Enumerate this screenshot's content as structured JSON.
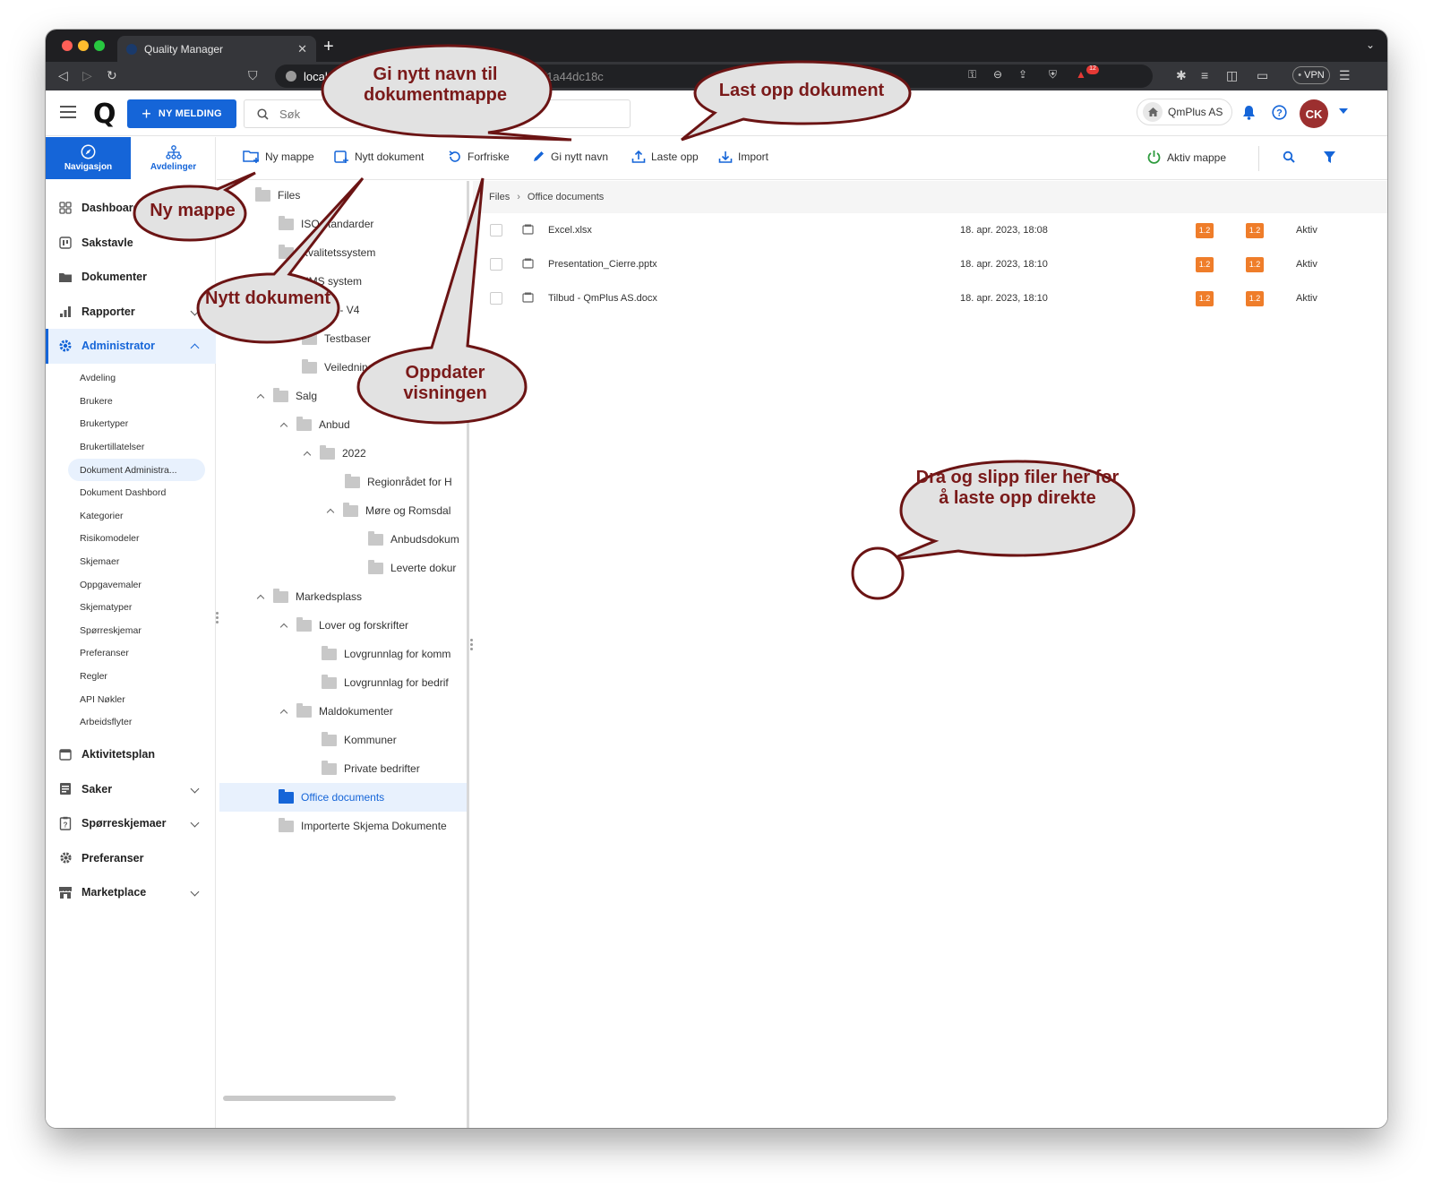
{
  "browser": {
    "tab_title": "Quality Manager",
    "url_host": "local",
    "url_rest": "mentId=9efb59cbf1a44dc18c",
    "vpn_label": "VPN",
    "shield_count": "12"
  },
  "header": {
    "new_message": "NY MELDING",
    "search_placeholder": "Søk",
    "company": "QmPlus AS",
    "avatar_initials": "CK"
  },
  "nav_tabs": [
    {
      "label": "Navigasjon",
      "icon": "compass-icon"
    },
    {
      "label": "Avdelinger",
      "icon": "org-chart-icon"
    }
  ],
  "menu": {
    "dashboard": "Dashboard",
    "sakstavle": "Sakstavle",
    "dokumenter": "Dokumenter",
    "rapporter": "Rapporter",
    "administrator": "Administrator",
    "admin_sub": [
      "Avdeling",
      "Brukere",
      "Brukertyper",
      "Brukertillatelser",
      "Dokument Administra...",
      "Dokument Dashbord",
      "Kategorier",
      "Risikomodeler",
      "Skjemaer",
      "Oppgavemaler",
      "Skjematyper",
      "Spørreskjemar",
      "Preferanser",
      "Regler",
      "API Nøkler",
      "Arbeidsflyter"
    ],
    "aktivitetsplan": "Aktivitetsplan",
    "saker": "Saker",
    "sporreskjemaer": "Spørreskjemaer",
    "preferanser": "Preferanser",
    "marketplace": "Marketplace"
  },
  "actions": {
    "ny_mappe": "Ny mappe",
    "nytt_dokument": "Nytt dokument",
    "forfriske": "Forfriske",
    "gi_nytt_navn": "Gi nytt navn",
    "laste_opp": "Laste opp",
    "import": "Import",
    "aktiv_mappe": "Aktiv mappe"
  },
  "tree": {
    "files": "Files",
    "iso": "ISO standarder",
    "kval": "Kvalitetssystem",
    "hms": "HMS system",
    "versjon": "Versjon - V4",
    "testbaser": "Testbaser",
    "veiledning": "Veiledning",
    "salg": "Salg",
    "anbud": "Anbud",
    "y2022": "2022",
    "regionradet": "Regionrådet for H",
    "more": "Møre og Romsdal",
    "anbudsdok": "Anbudsdokum",
    "leverte": "Leverte dokur",
    "markedsplass": "Markedsplass",
    "lover": "Lover og forskrifter",
    "lovgrunn1": "Lovgrunnlag for komm",
    "lovgrunn2": "Lovgrunnlag for bedrif",
    "maldok": "Maldokumenter",
    "kommuner": "Kommuner",
    "private": "Private bedrifter",
    "office": "Office documents",
    "importerte": "Importerte Skjema Dokumente"
  },
  "breadcrumb": [
    "Files",
    "Office documents"
  ],
  "files": [
    {
      "name": "Excel.xlsx",
      "date": "18. apr. 2023, 18:08",
      "v1": "1.2",
      "v2": "1.2",
      "status": "Aktiv"
    },
    {
      "name": "Presentation_Cierre.pptx",
      "date": "18. apr. 2023, 18:10",
      "v1": "1.2",
      "v2": "1.2",
      "status": "Aktiv"
    },
    {
      "name": "Tilbud - QmPlus AS.docx",
      "date": "18. apr. 2023, 18:10",
      "v1": "1.2",
      "v2": "1.2",
      "status": "Aktiv"
    }
  ],
  "callouts": {
    "rename_folder": "Gi nytt navn til dokumentmappe",
    "upload": "Last opp dokument",
    "new_folder": "Ny mappe",
    "new_doc": "Nytt dokument",
    "refresh": "Oppdater visningen",
    "drag_drop": "Dra og slipp filer her for å laste opp direkte"
  },
  "colors": {
    "accent": "#1565d8",
    "version_badge": "#ef7d2a",
    "callout_text": "#7a1a1a",
    "callout_fill": "#e2e2e2"
  }
}
